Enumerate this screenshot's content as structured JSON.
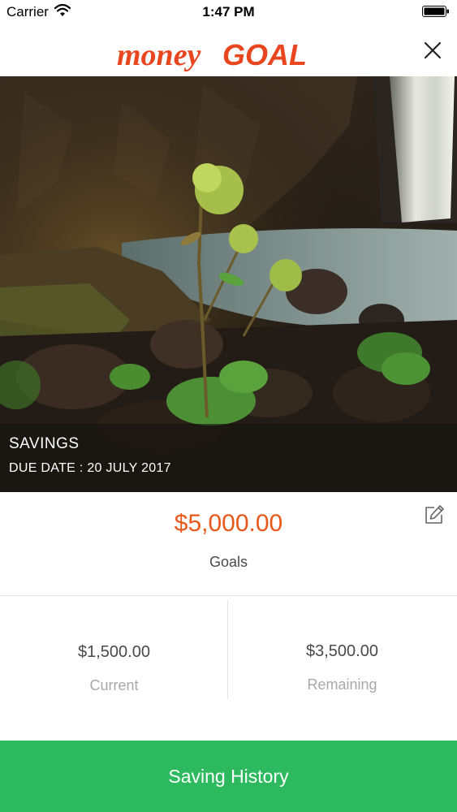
{
  "status_bar": {
    "carrier": "Carrier",
    "time": "1:47 PM",
    "icons": [
      "wifi-icon",
      "battery-icon"
    ]
  },
  "header": {
    "logo_text_1": "money",
    "logo_text_2": "GOAL",
    "close_icon": "close-icon",
    "brand_color": "#e8461f"
  },
  "goal": {
    "title": "SAVINGS",
    "due_date": "DUE DATE : 20 JULY 2017",
    "amount": "$5,000.00",
    "amount_label": "Goals",
    "edit_icon": "edit-icon",
    "amount_color": "#e8581a"
  },
  "stats": {
    "current_value": "$1,500.00",
    "current_label": "Current",
    "remaining_value": "$3,500.00",
    "remaining_label": "Remaining"
  },
  "actions": {
    "history_label": "Saving History",
    "history_color": "#2dba5f"
  }
}
